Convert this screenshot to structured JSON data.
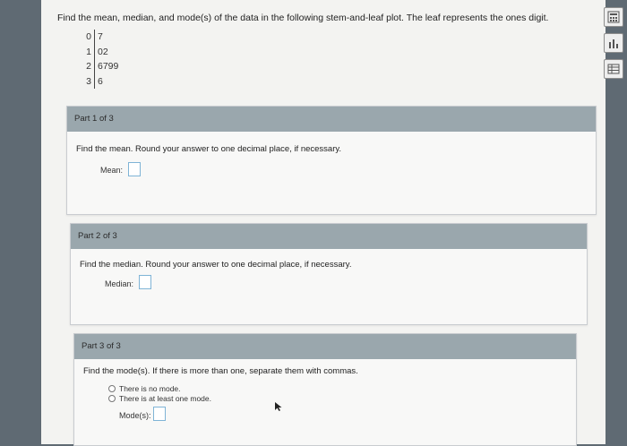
{
  "question": "Find the mean, median, and mode(s) of the data in the following stem-and-leaf plot. The leaf represents the ones digit.",
  "stem_leaf": [
    {
      "stem": "0",
      "leaf": "7"
    },
    {
      "stem": "1",
      "leaf": "02"
    },
    {
      "stem": "2",
      "leaf": "6799"
    },
    {
      "stem": "3",
      "leaf": "6"
    }
  ],
  "part1": {
    "header": "Part 1 of 3",
    "instruction": "Find the mean. Round your answer to one decimal place, if necessary.",
    "field_label": "Mean:"
  },
  "part2": {
    "header": "Part 2 of 3",
    "instruction": "Find the median. Round your answer to one decimal place, if necessary.",
    "field_label": "Median:"
  },
  "part3": {
    "header": "Part 3 of 3",
    "instruction": "Find the mode(s). If there is more than one, separate them with commas.",
    "option_no_mode": "There is no mode.",
    "option_has_mode": "There is at least one mode.",
    "field_label": "Mode(s):"
  },
  "toolbar": {
    "icons": [
      "calculator-icon",
      "data-icon",
      "table-icon"
    ]
  },
  "colors": {
    "header_bg": "#9aa7ad",
    "input_border": "#7fb4d6"
  }
}
